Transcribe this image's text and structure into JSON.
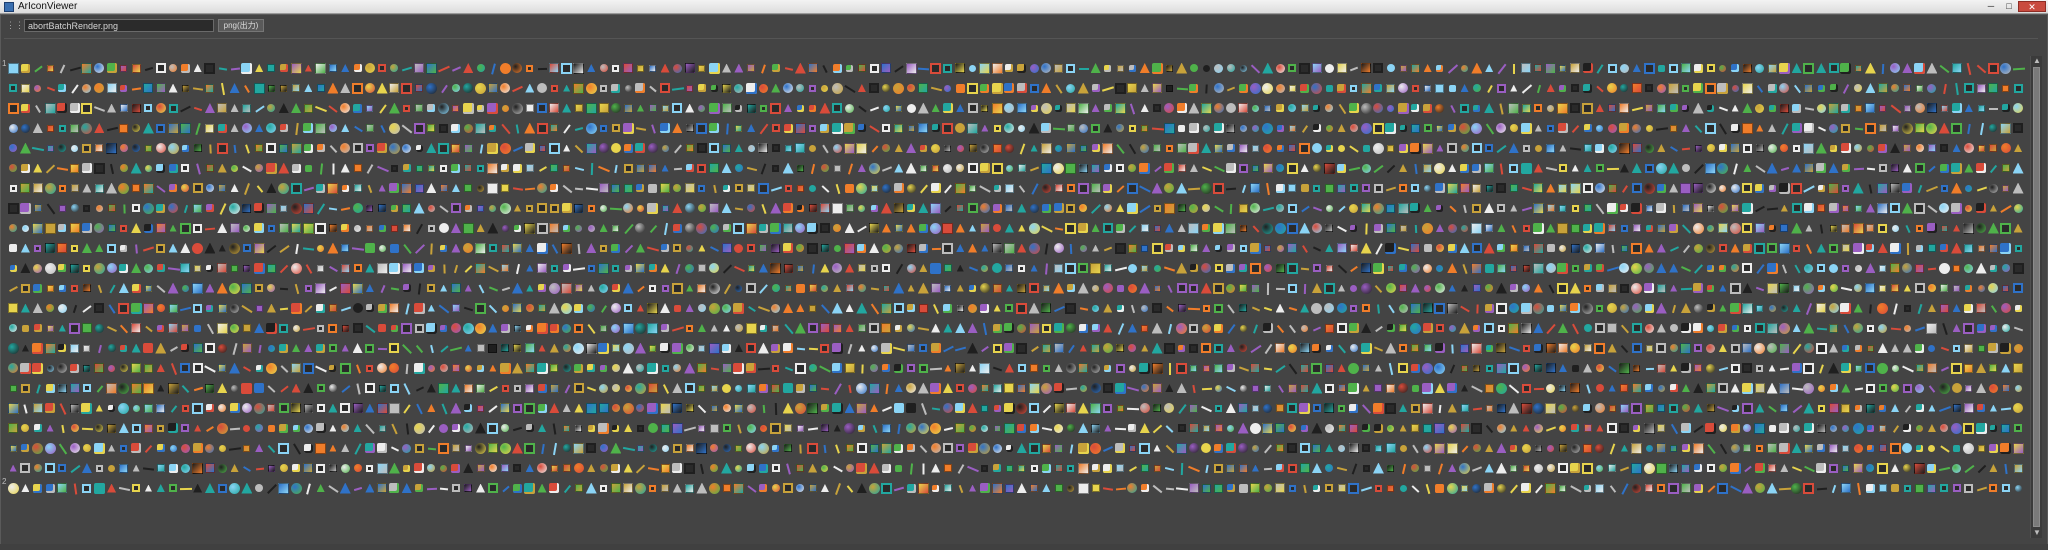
{
  "window": {
    "title": "ArIconViewer",
    "minimize_glyph": "─",
    "maximize_glyph": "□",
    "close_glyph": "✕"
  },
  "toolbar": {
    "grip_glyph": "⋮⋮",
    "filename_value": "abortBatchRender.png",
    "format_button_label": "png(出力)"
  },
  "row_labels": [
    "1",
    "2"
  ],
  "icon_grid": {
    "rows": 22,
    "columns": 164,
    "description_palette": [
      "#bdbdbd",
      "#1f1f1f",
      "#2f72c8",
      "#c8a23a",
      "#d94b3a",
      "#4fb24a",
      "#8bd4f5",
      "#e7d44d",
      "#9a5ec2",
      "#ededed",
      "#f07d2a",
      "#22a7a0"
    ]
  },
  "scrollbar": {
    "up_glyph": "▲",
    "down_glyph": "▼"
  }
}
